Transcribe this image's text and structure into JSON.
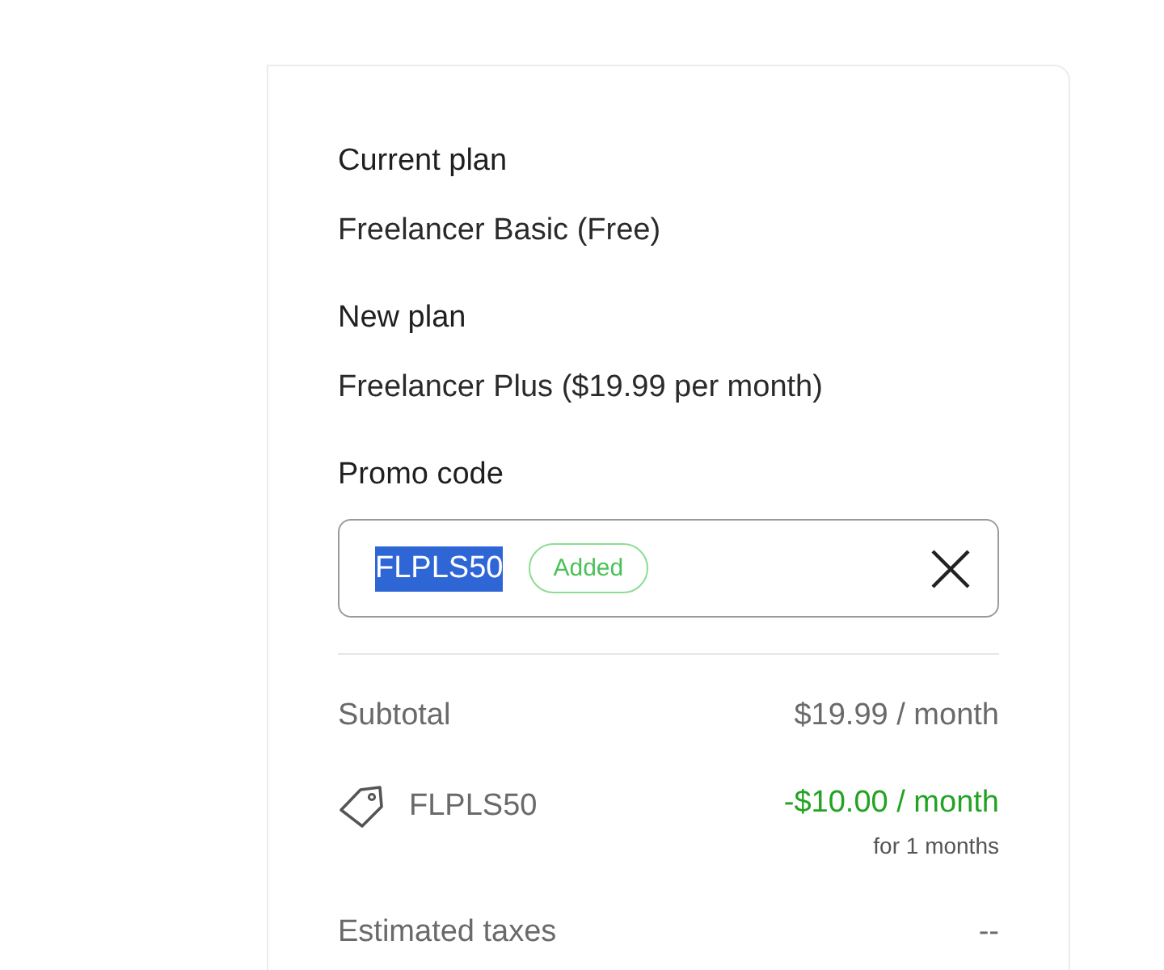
{
  "plan": {
    "current_label": "Current plan",
    "current_value": "Freelancer Basic (Free)",
    "new_label": "New plan",
    "new_value": "Freelancer Plus ($19.99 per month)"
  },
  "promo": {
    "label": "Promo code",
    "code": "FLPLS50",
    "selected": true,
    "badge": "Added"
  },
  "summary": {
    "subtotal_label": "Subtotal",
    "subtotal_value": "$19.99 / month",
    "discount_code": "FLPLS50",
    "discount_value": "-$10.00 / month",
    "discount_note": "for 1 months",
    "taxes_label": "Estimated taxes",
    "taxes_value": "--"
  }
}
